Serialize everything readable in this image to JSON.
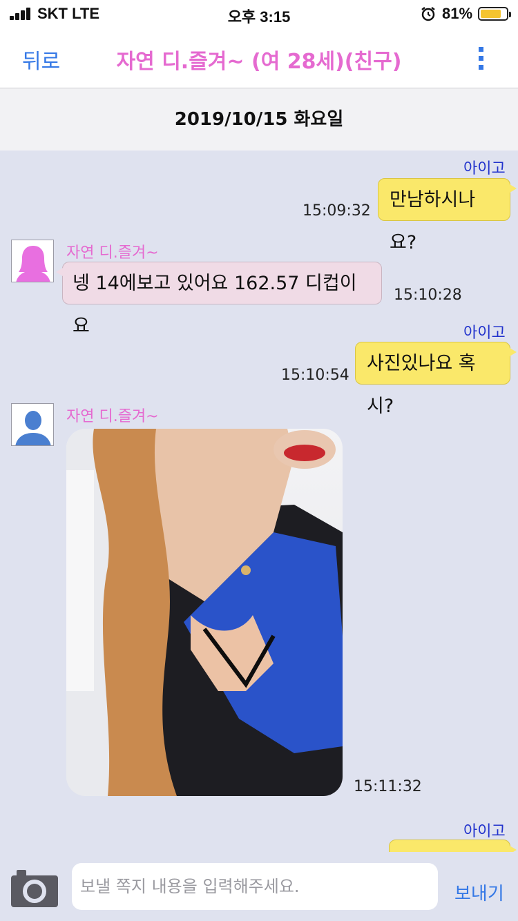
{
  "status_bar": {
    "carrier": "SKT  LTE",
    "time": "오후 3:15",
    "battery_percent": "81%",
    "battery_level": 0.81,
    "battery_color": "#f4c430",
    "icons": [
      "signal-bars-icon",
      "alarm-clock-icon",
      "battery-icon"
    ]
  },
  "nav": {
    "back_label": "뒤로",
    "title": "자연 디.즐겨~ (여 28세)(친구)",
    "title_color": "#e56ad0",
    "menu_icon": "vertical-dots-icon",
    "accent_color": "#3478e6"
  },
  "date_header": "2019/10/15 화요일",
  "messages": [
    {
      "direction": "out",
      "sender": "아이고",
      "text": "만남하시나요?",
      "time": "15:09:32"
    },
    {
      "direction": "in",
      "sender": "자연 디.즐겨~",
      "avatar": "female-avatar-icon",
      "text": "넹 14에보고 있어요 162.57 디컵이요",
      "time": "15:10:28"
    },
    {
      "direction": "out",
      "sender": "아이고",
      "text": "사진있나요 혹시?",
      "time": "15:10:54"
    },
    {
      "direction": "in",
      "sender": "자연 디.즐겨~",
      "avatar": "default-avatar-icon",
      "image": "photo-attachment",
      "time": "15:11:32"
    },
    {
      "direction": "out",
      "sender": "아이고",
      "text": ""
    }
  ],
  "composer": {
    "camera_icon": "camera-icon",
    "placeholder": "보낼 쪽지 내용을 입력해주세요.",
    "send_label": "보내기"
  }
}
